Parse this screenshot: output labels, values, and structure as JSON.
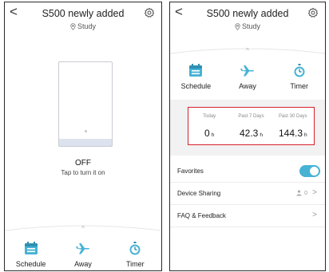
{
  "header": {
    "back_label": "<",
    "title": "S500 newly added",
    "location": "Study"
  },
  "device": {
    "state": "OFF",
    "hint": "Tap to turn it on"
  },
  "modes": [
    {
      "label": "Schedule",
      "icon": "calendar-icon"
    },
    {
      "label": "Away",
      "icon": "airplane-icon"
    },
    {
      "label": "Timer",
      "icon": "stopwatch-icon"
    }
  ],
  "usage": [
    {
      "label": "Today",
      "value": "0",
      "unit": "h"
    },
    {
      "label": "Past 7 Days",
      "value": "42.3",
      "unit": "h"
    },
    {
      "label": "Past 30 Days",
      "value": "144.3",
      "unit": "h"
    }
  ],
  "settings": {
    "favorites": {
      "label": "Favorites",
      "enabled": true
    },
    "sharing": {
      "label": "Device Sharing",
      "count": "0",
      "arrow": ">"
    },
    "faq": {
      "label": "FAQ & Feedback",
      "arrow": ">"
    }
  },
  "colors": {
    "accent": "#46b3d5",
    "highlight_border": "#d71f2b"
  }
}
